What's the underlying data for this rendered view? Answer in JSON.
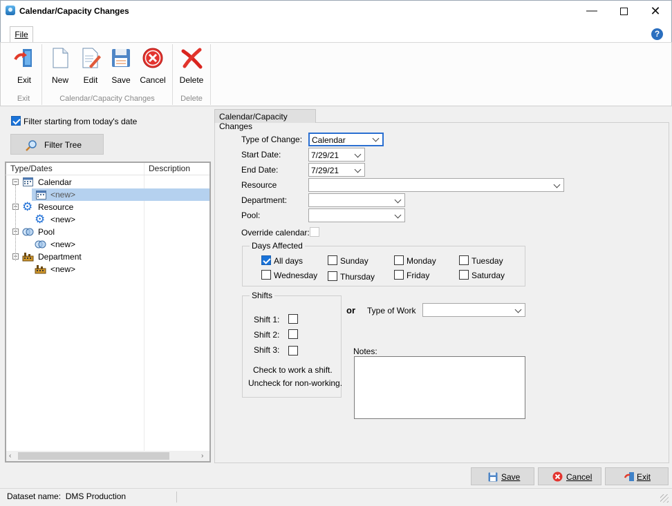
{
  "window": {
    "title": "Calendar/Capacity Changes"
  },
  "ribbon": {
    "file_tab": "File",
    "buttons": {
      "exit": "Exit",
      "new": "New",
      "edit": "Edit",
      "save": "Save",
      "cancel": "Cancel",
      "delete": "Delete"
    },
    "groups": {
      "exit": "Exit",
      "changes": "Calendar/Capacity Changes",
      "delete": "Delete"
    }
  },
  "left": {
    "filter_label": "Filter starting from today's date",
    "filter_checked": true,
    "filter_tree_label": "Filter Tree",
    "columns": [
      "Type/Dates",
      "Description"
    ],
    "tree": [
      {
        "label": "Calendar",
        "icon": "calendar-icon"
      },
      {
        "label": "<new>",
        "icon": "calendar-icon",
        "selected": true
      },
      {
        "label": "Resource",
        "icon": "gear-icon"
      },
      {
        "label": "<new>",
        "icon": "gear-icon"
      },
      {
        "label": "Pool",
        "icon": "pool-icon"
      },
      {
        "label": "<new>",
        "icon": "pool-icon"
      },
      {
        "label": "Department",
        "icon": "department-icon"
      },
      {
        "label": "<new>",
        "icon": "department-icon"
      }
    ]
  },
  "form": {
    "tab_label": "Calendar/Capacity Changes",
    "type_of_change_label": "Type of Change:",
    "type_of_change_value": "Calendar",
    "start_date_label": "Start Date:",
    "start_date_value": "7/29/21",
    "end_date_label": "End Date:",
    "end_date_value": "7/29/21",
    "resource_label": "Resource",
    "department_label": "Department:",
    "pool_label": "Pool:",
    "override_label": "Override calendar:",
    "days_title": "Days Affected",
    "days": {
      "all": "All days",
      "sun": "Sunday",
      "mon": "Monday",
      "tue": "Tuesday",
      "wed": "Wednesday",
      "thu": "Thursday",
      "fri": "Friday",
      "sat": "Saturday"
    },
    "shifts_title": "Shifts",
    "shift1": "Shift 1:",
    "shift2": "Shift 2:",
    "shift3": "Shift 3:",
    "shift_hint1": "Check to work a shift.",
    "shift_hint2": "Uncheck for non-working.",
    "or_label": "or",
    "type_of_work_label": "Type of Work",
    "notes_label": "Notes:"
  },
  "footer": {
    "save": "Save",
    "cancel": "Cancel",
    "exit": "Exit"
  },
  "status": {
    "dataset": "Dataset name:  DMS Production"
  }
}
